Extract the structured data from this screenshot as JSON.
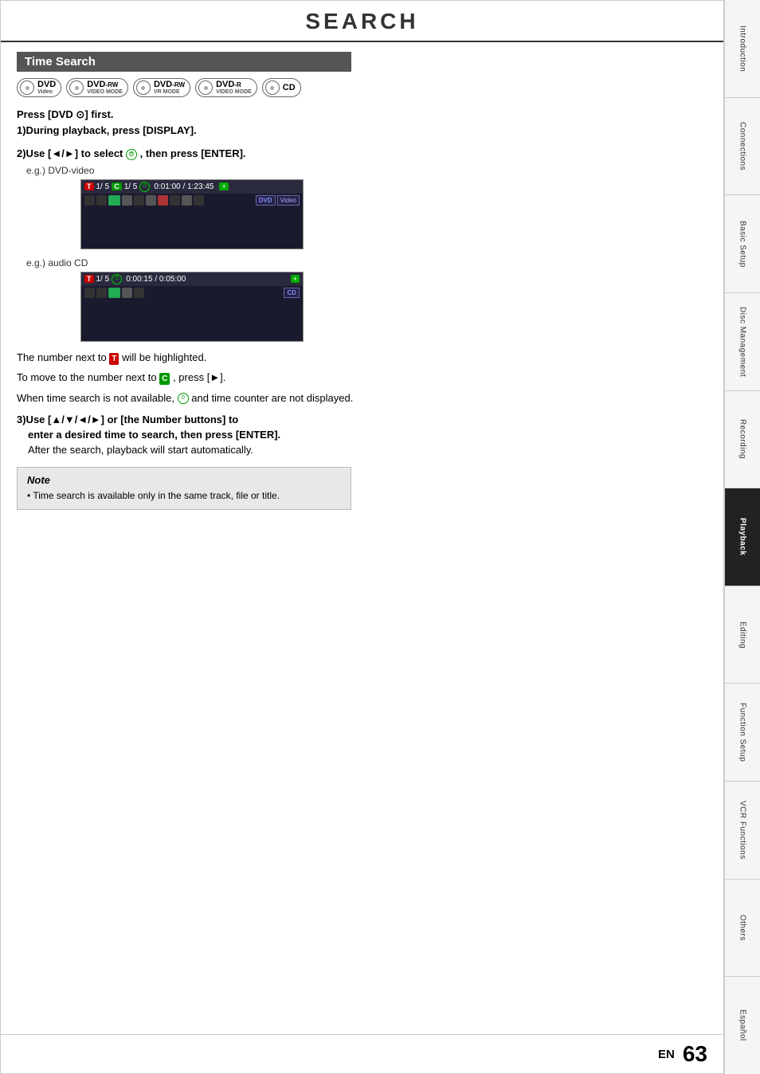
{
  "page": {
    "title": "SEARCH",
    "number": "63",
    "lang": "EN"
  },
  "section": {
    "title": "Time Search"
  },
  "disc_badges": [
    {
      "label_main": "DVD",
      "label_sub": "Video",
      "id": "dvd-video"
    },
    {
      "label_main": "DVD",
      "label_sub": "VIDEO MODE",
      "suffix": "-RW",
      "id": "dvd-rw-video"
    },
    {
      "label_main": "DVD",
      "label_sub": "VR MODE",
      "suffix": "-RW",
      "id": "dvd-rw-vr"
    },
    {
      "label_main": "DVD",
      "label_sub": "VIDEO MODE",
      "suffix": "-R",
      "id": "dvd-r-video"
    },
    {
      "label_main": "CD",
      "label_sub": "",
      "id": "cd"
    }
  ],
  "instructions": {
    "press_dvd_first": "Press [DVD ⊙] first.",
    "step1": "1)During playback, press [DISPLAY].",
    "step2_header": "2)Use [◄/►] to select  , then press [ENTER].",
    "step2_eg1": "e.g.) DVD-video",
    "step2_eg2": "e.g.) audio CD",
    "osd1": {
      "t_label": "T",
      "track_num": "1/ 5",
      "c_label": "C",
      "chapter_num": "1/ 5",
      "time": "0:01:00 / 1:23:45",
      "dvd_tag": "DVD",
      "video_tag": "Video"
    },
    "osd2": {
      "t_label": "T",
      "track_num": "1/ 5",
      "time": "0:00:15 / 0:05:00",
      "cd_tag": "CD"
    },
    "highlight_note": "The number next to  T  will be highlighted.",
    "move_note": "To move to the number next to  C , press [►].",
    "unavailable_note": "When time search is not available,  and time counter are not displayed.",
    "step3_header": "3)Use [▲/▼/◄/►] or [the Number buttons] to",
    "step3_cont": "enter a desired time to search, then press [ENTER].",
    "step3_after": "After the search, playback will start automatically."
  },
  "note": {
    "title": "Note",
    "content": "• Time search is available only in the same track, file or title."
  },
  "sidebar": {
    "tabs": [
      {
        "label": "Introduction",
        "active": false,
        "id": "tab-introduction"
      },
      {
        "label": "Connections",
        "active": false,
        "id": "tab-connections"
      },
      {
        "label": "Basic Setup",
        "active": false,
        "id": "tab-basic-setup"
      },
      {
        "label": "Disc Management",
        "active": false,
        "id": "tab-disc-management"
      },
      {
        "label": "Recording",
        "active": false,
        "id": "tab-recording"
      },
      {
        "label": "Playback",
        "active": true,
        "id": "tab-playback"
      },
      {
        "label": "Editing",
        "active": false,
        "id": "tab-editing"
      },
      {
        "label": "Function Setup",
        "active": false,
        "id": "tab-function-setup"
      },
      {
        "label": "VCR Functions",
        "active": false,
        "id": "tab-vcr-functions"
      },
      {
        "label": "Others",
        "active": false,
        "id": "tab-others"
      },
      {
        "label": "Español",
        "active": false,
        "id": "tab-espanol"
      }
    ]
  }
}
